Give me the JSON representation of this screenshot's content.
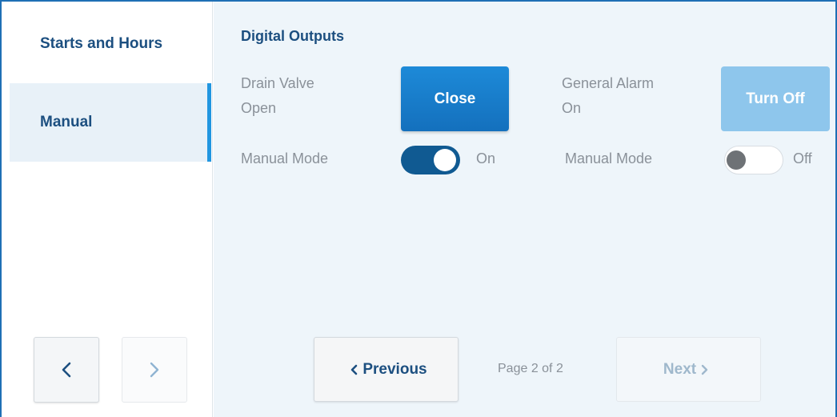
{
  "sidebar": {
    "items": [
      {
        "label": "Starts and Hours"
      },
      {
        "label": "Manual"
      }
    ]
  },
  "main": {
    "section_title": "Digital Outputs",
    "outputs": [
      {
        "name_line1": "Drain Valve",
        "name_line2": "Open",
        "button_label": "Close",
        "mode_label": "Manual Mode",
        "mode_state": "On"
      },
      {
        "name_line1": "General Alarm",
        "name_line2": "On",
        "button_label": "Turn Off",
        "mode_label": "Manual Mode",
        "mode_state": "Off"
      }
    ]
  },
  "pager": {
    "previous_label": "Previous",
    "next_label": "Next",
    "page_info": "Page 2 of 2"
  },
  "colors": {
    "accent": "#1c4f80",
    "primary_button": "#1470bd",
    "active_indicator": "#2196e0",
    "panel_background": "#eef5fa"
  }
}
